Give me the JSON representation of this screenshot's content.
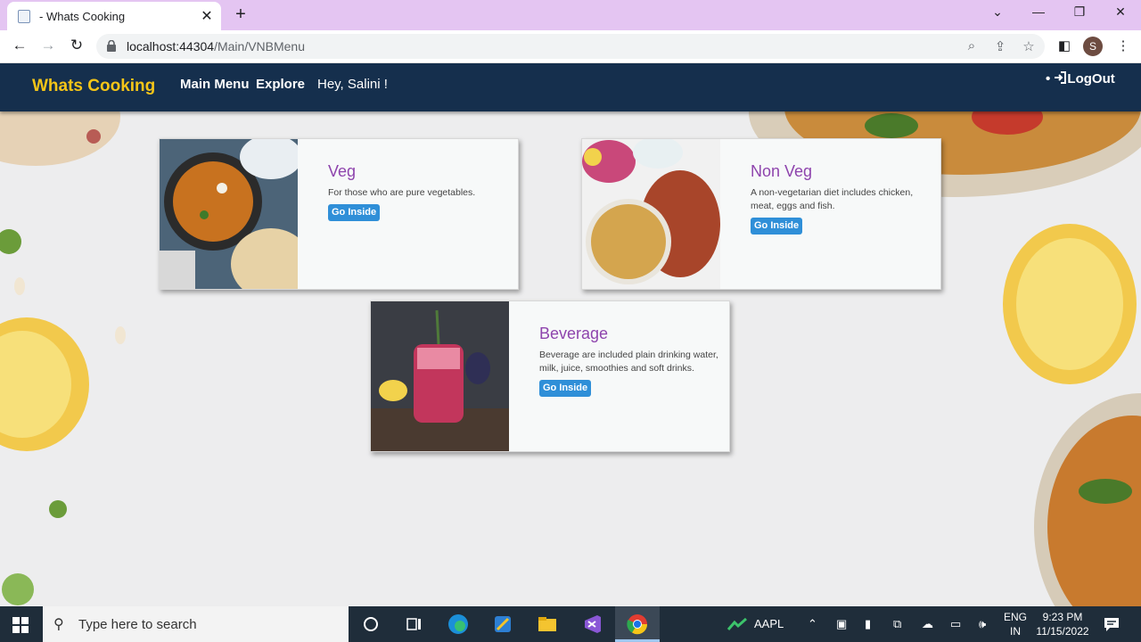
{
  "browser": {
    "tab_title": "- Whats Cooking",
    "url_host": "localhost:44304",
    "url_path": "/Main/VNBMenu",
    "profile_initial": "S"
  },
  "navbar": {
    "brand": "Whats Cooking",
    "links": [
      "Main Menu",
      "Explore"
    ],
    "greeting": "Hey, Salini !",
    "logout": "LogOut"
  },
  "cards": [
    {
      "title": "Veg",
      "description": "For those who are pure vegetables.",
      "button": "Go Inside"
    },
    {
      "title": "Non Veg",
      "description": "A non-vegetarian diet includes chicken, meat, eggs and fish.",
      "button": "Go Inside"
    },
    {
      "title": "Beverage",
      "description": "Beverage are included plain drinking water, milk, juice, smoothies and soft drinks.",
      "button": "Go Inside"
    }
  ],
  "taskbar": {
    "search_placeholder": "Type here to search",
    "stock": "AAPL",
    "lang_line1": "ENG",
    "lang_line2": "IN",
    "time": "9:23 PM",
    "date": "11/15/2022"
  },
  "colors": {
    "navbar_bg": "#152f4d",
    "brand": "#f5c518",
    "card_title": "#8e44ad",
    "button": "#2f8fd8"
  }
}
